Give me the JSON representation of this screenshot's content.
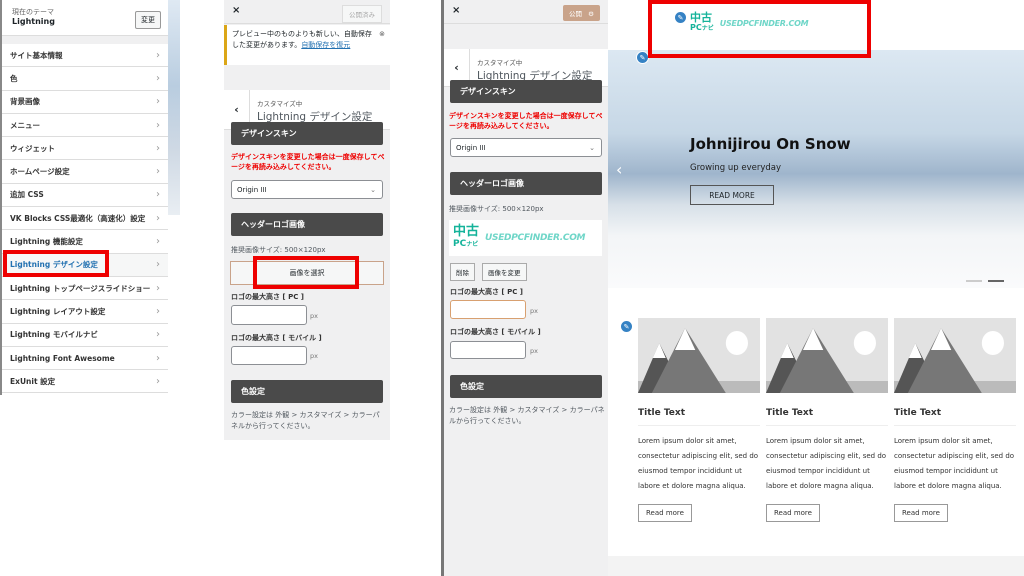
{
  "panel_main": {
    "current_theme_label": "現在のテーマ",
    "theme_name": "Lightning",
    "change_button": "変更",
    "items": [
      "サイト基本情報",
      "色",
      "背景画像",
      "メニュー",
      "ウィジェット",
      "ホームページ設定",
      "追加 CSS",
      "VK Blocks CSS最適化（高速化）設定",
      "Lightning 機能設定",
      "Lightning デザイン設定",
      "Lightning トップページスライドショー",
      "Lightning レイアウト設定",
      "Lightning モバイルナビ",
      "Lightning Font Awesome",
      "ExUnit 設定"
    ],
    "active_index": 9
  },
  "panel_before": {
    "close": "×",
    "publish_button": "公開済み",
    "notice": "プレビュー中のものよりも新しい、自動保存した変更があります。",
    "notice_link": "自動保存を復元",
    "customizing": "カスタマイズ中",
    "title": "Lightning デザイン設定",
    "skin_header": "デザインスキン",
    "skin_warning": "デザインスキンを変更した場合は一度保存してページを再読み込みしてください。",
    "skin_value": "Origin III",
    "logo_header": "ヘッダーロゴ画像",
    "logo_size": "推奨画像サイズ: 500×120px",
    "select_image": "画像を選択",
    "max_pc": "ロゴの最大高さ [ PC ]",
    "max_mobile": "ロゴの最大高さ [ モバイル ]",
    "unit": "px",
    "color_header": "色設定",
    "color_note": "カラー設定は 外観 > カスタマイズ > カラーパネルから行ってください。"
  },
  "panel_after": {
    "close": "×",
    "publish_button": "公開",
    "gear": "⚙",
    "customizing": "カスタマイズ中",
    "title": "Lightning デザイン設定",
    "skin_header": "デザインスキン",
    "skin_warning": "デザインスキンを変更した場合は一度保存してページを再読み込みしてください。",
    "skin_value": "Origin III",
    "logo_header": "ヘッダーロゴ画像",
    "logo_size": "推奨画像サイズ: 500×120px",
    "logo_jp": "中古",
    "logo_pc": "PC",
    "logo_navi": "ナビ",
    "logo_en": "USEDPCFINDER.COM",
    "remove": "削除",
    "change_image": "画像を変更",
    "max_pc": "ロゴの最大高さ [ PC ]",
    "max_mobile": "ロゴの最大高さ [ モバイル ]",
    "unit": "px",
    "color_header": "色設定",
    "color_note": "カラー設定は 外観 > カスタマイズ > カラーパネルから行ってください。"
  },
  "preview": {
    "logo_jp": "中古",
    "logo_pc": "PC",
    "logo_navi": "ナビ",
    "logo_en": "USEDPCFINDER.COM",
    "hero_title": "Johnijirou On Snow",
    "hero_sub": "Growing up everyday",
    "hero_button": "READ MORE",
    "slide_count": 2,
    "active_slide": 2,
    "cards": [
      {
        "title": "Title Text",
        "text": "Lorem ipsum dolor sit amet, consectetur adipiscing elit, sed do eiusmod tempor incididunt ut labore et dolore magna aliqua.",
        "button": "Read more"
      },
      {
        "title": "Title Text",
        "text": "Lorem ipsum dolor sit amet, consectetur adipiscing elit, sed do eiusmod tempor incididunt ut labore et dolore magna aliqua.",
        "button": "Read more"
      },
      {
        "title": "Title Text",
        "text": "Lorem ipsum dolor sit amet, consectetur adipiscing elit, sed do eiusmod tempor incididunt ut labore et dolore magna aliqua.",
        "button": "Read more"
      }
    ]
  },
  "colors": {
    "accent": "#2271b1",
    "highlight": "#e00000",
    "section_bar": "#4a4a4a",
    "logo_green": "#14b39a",
    "publish": "#c9a38a"
  }
}
